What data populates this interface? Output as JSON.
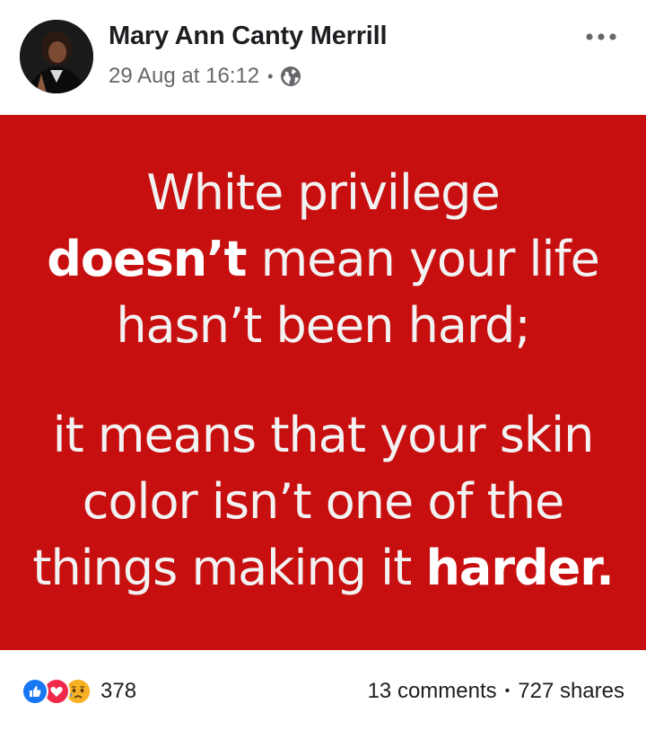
{
  "post": {
    "author": "Mary Ann Canty Merrill",
    "timestamp": "29 Aug at 16:12",
    "separator": "•",
    "privacy_icon": "globe-icon",
    "more_icon": "more-options-icon"
  },
  "image": {
    "background_color": "#c80f0f",
    "text_color": "#ffffff",
    "lines": {
      "l1": "White privilege",
      "l2_bold": "doesn’t",
      "l2_rest": " mean your life",
      "l3": "hasn’t been hard;",
      "l4": "it means that your skin",
      "l5": "color isn’t one of the",
      "l6_rest": "things making it ",
      "l6_bold": "harder."
    }
  },
  "footer": {
    "reaction_icons": [
      "like-icon",
      "love-icon",
      "sad-icon"
    ],
    "reaction_count": "378",
    "comments": "13 comments",
    "separator": "•",
    "shares": "727 shares"
  },
  "colors": {
    "like": "#1877f2",
    "love": "#f0284a",
    "sad": "#f7b125",
    "secondary_text": "#65676b"
  }
}
